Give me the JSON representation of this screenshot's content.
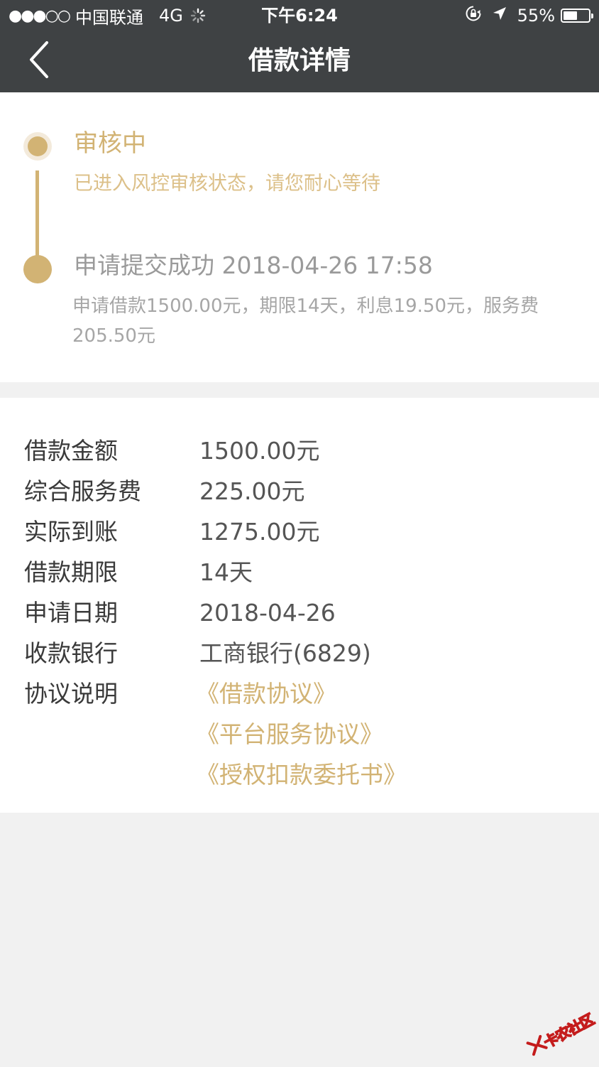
{
  "status_bar": {
    "carrier": "中国联通",
    "network": "4G",
    "time": "下午6:24",
    "battery_percent": "55%",
    "battery_level": 0.55
  },
  "nav": {
    "title": "借款详情"
  },
  "timeline": {
    "steps": [
      {
        "title": "审核中",
        "description": "已进入风控审核状态，请您耐心等待"
      },
      {
        "title": "申请提交成功 2018-04-26 17:58",
        "description": "申请借款1500.00元，期限14天，利息19.50元，服务费205.50元"
      }
    ]
  },
  "details": {
    "rows": [
      {
        "label": "借款金额",
        "value": "1500.00元"
      },
      {
        "label": "综合服务费",
        "value": "225.00元"
      },
      {
        "label": "实际到账",
        "value": "1275.00元"
      },
      {
        "label": "借款期限",
        "value": "14天"
      },
      {
        "label": "申请日期",
        "value": "2018-04-26"
      },
      {
        "label": "收款银行",
        "value": "工商银行(6829)"
      }
    ],
    "agreements_label": "协议说明",
    "agreements": [
      "《借款协议》",
      "《平台服务协议》",
      "《授权扣款委托书》"
    ]
  },
  "watermark": {
    "text": "卡农社区"
  },
  "colors": {
    "header_bg": "#3f4244",
    "accent_gold": "#d2b374",
    "page_bg": "#f1f1f1",
    "watermark_red": "#c41c1c"
  }
}
